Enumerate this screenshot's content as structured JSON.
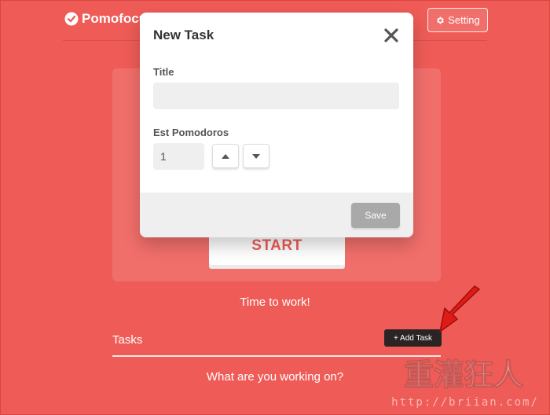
{
  "app": {
    "brand": "Pomofocus",
    "setting_label": "Setting"
  },
  "timer": {
    "start_label": "START",
    "status_text": "Time to work!"
  },
  "tasks": {
    "label": "Tasks",
    "add_task_label": "+ Add Task",
    "prompt_text": "What are you working on?"
  },
  "modal": {
    "title": "New Task",
    "title_field_label": "Title",
    "title_value": "",
    "pomodoros_label": "Est Pomodoros",
    "pomodoros_value": "1",
    "save_label": "Save"
  },
  "watermark": {
    "text": "重灌狂人",
    "url": "http://briian.com/"
  },
  "colors": {
    "background": "#ef5c57",
    "annotation_arrow": "#e01b17",
    "add_task_bg": "#2b2424",
    "save_disabled": "#a9a9a9"
  },
  "icons": [
    "check-circle-icon",
    "gear-icon",
    "close-icon",
    "arrow-up-icon",
    "arrow-down-icon",
    "pointer-arrow-icon"
  ]
}
